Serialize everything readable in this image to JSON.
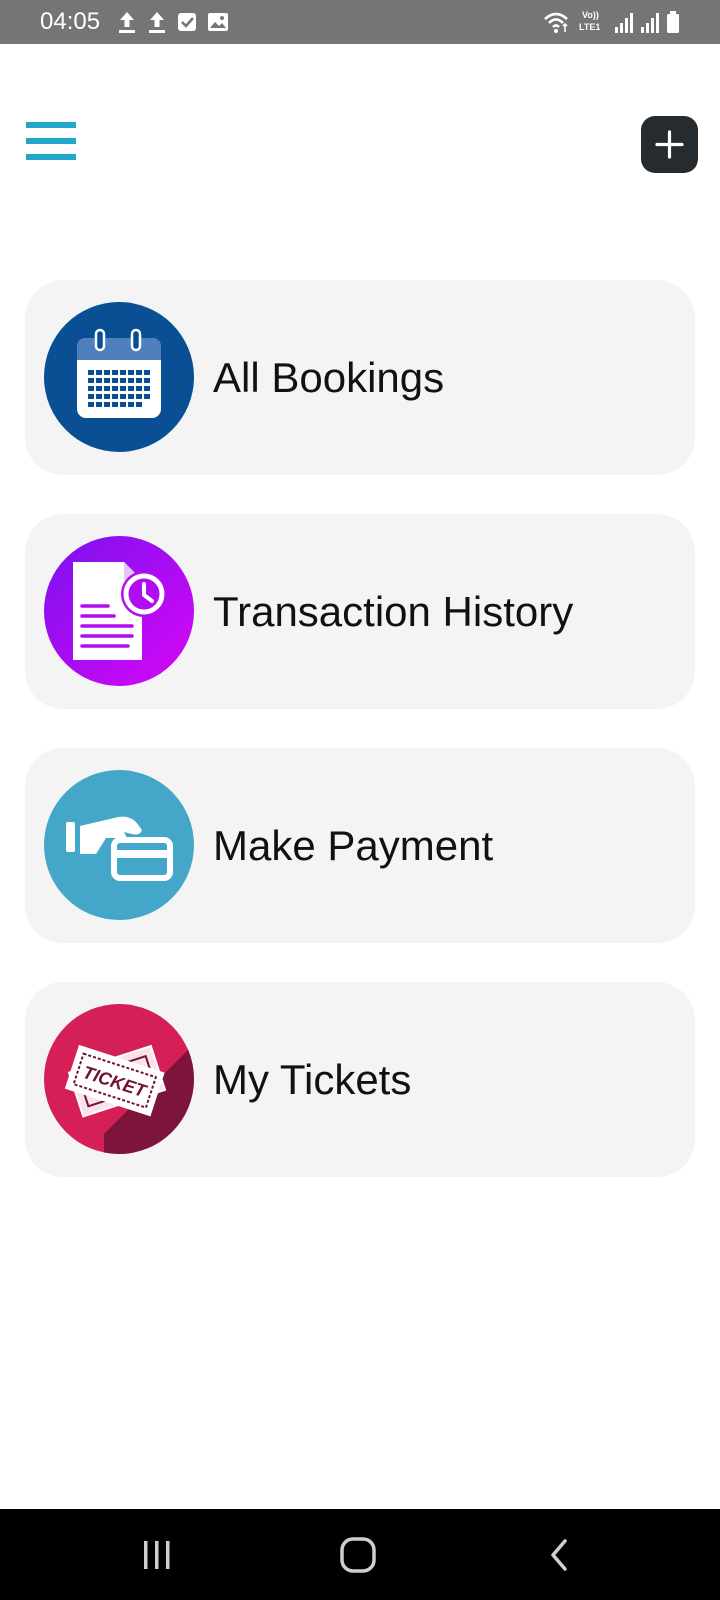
{
  "status_bar": {
    "time": "04:05",
    "left_icons": [
      "upload-icon",
      "upload-icon",
      "checkbox-icon",
      "image-icon"
    ],
    "right_icons": [
      "wifi-icon",
      "volte-icon",
      "signal-icon",
      "signal-icon",
      "battery-icon"
    ],
    "volte_label": "Vo)) LTE1"
  },
  "header": {
    "menu_icon": "hamburger-menu-icon",
    "add_icon": "plus-icon",
    "accent_color": "#20a8c9"
  },
  "menu_cards": [
    {
      "label": "All Bookings",
      "icon": "calendar-icon",
      "icon_bg": "#0a4f93"
    },
    {
      "label": "Transaction History",
      "icon": "document-clock-icon",
      "icon_bg": "#b20cf2"
    },
    {
      "label": "Make Payment",
      "icon": "hand-card-payment-icon",
      "icon_bg": "#44a7c9"
    },
    {
      "label": "My Tickets",
      "icon": "ticket-icon",
      "icon_bg": "#d42057",
      "ticket_text": "TICKET"
    }
  ],
  "nav_bar": {
    "buttons": [
      "recent-apps-icon",
      "home-icon",
      "back-icon"
    ]
  }
}
